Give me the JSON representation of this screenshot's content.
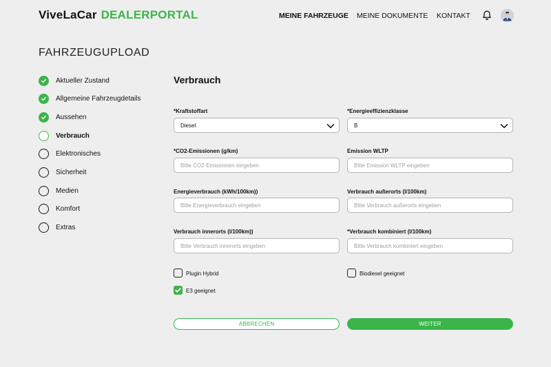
{
  "header": {
    "logo_brand": "ViveLaCar",
    "logo_portal": "DEALERPORTAL",
    "nav": [
      "MEINE FAHRZEUGE",
      "MEINE DOKUMENTE",
      "KONTAKT"
    ],
    "icons": [
      "bell-icon",
      "avatar"
    ]
  },
  "page_title": "FAHRZEUGUPLOAD",
  "steps": [
    {
      "label": "Aktueller Zustand",
      "status": "done"
    },
    {
      "label": "Allgemeine Fahrzeugdetails",
      "status": "done"
    },
    {
      "label": "Aussehen",
      "status": "done"
    },
    {
      "label": "Verbrauch",
      "status": "current"
    },
    {
      "label": "Elektronisches",
      "status": "todo"
    },
    {
      "label": "Sicherheit",
      "status": "todo"
    },
    {
      "label": "Medien",
      "status": "todo"
    },
    {
      "label": "Komfort",
      "status": "todo"
    },
    {
      "label": "Extras",
      "status": "todo"
    }
  ],
  "form": {
    "section_title": "Verbrauch",
    "fuel": {
      "label": "*Kraftstoffart",
      "value": "Diesel"
    },
    "efficiency": {
      "label": "*Energieeffizienzklasse",
      "value": "B"
    },
    "co2": {
      "label": "*CO2-Emissionen (g/km)",
      "placeholder": "Bitte CO2-Emissionen eingeben"
    },
    "wltp": {
      "label": "Emission WLTP",
      "placeholder": "Bitte Emission WLTP eingeben"
    },
    "energy": {
      "label": "Energieverbrauch (kWh/100km))",
      "placeholder": "Bitte Energieverbrauch eingeben"
    },
    "outside": {
      "label": "Verbrauch außerorts (l/100km)",
      "placeholder": "Bitte Verbrauch außerorts eingeben"
    },
    "inside": {
      "label": "Verbrauch innerorts (l/100km))",
      "placeholder": "Bitte Verbrauch innerorts eingeben"
    },
    "combined": {
      "label": "*Verbrauch kombiniert (l/100km)",
      "placeholder": "Bitte Verbrauch kombiniert eingeben"
    },
    "plugin_hybrid": {
      "label": "Plugin Hybrid",
      "checked": false
    },
    "biodiesel": {
      "label": "Biodiesel geeignet",
      "checked": false
    },
    "e3": {
      "label": "E3 geeignet",
      "checked": true
    }
  },
  "buttons": {
    "cancel": "ABBRECHEN",
    "next": "WEITER"
  },
  "colors": {
    "accent": "#3bb54a",
    "background": "#eeeeee"
  }
}
